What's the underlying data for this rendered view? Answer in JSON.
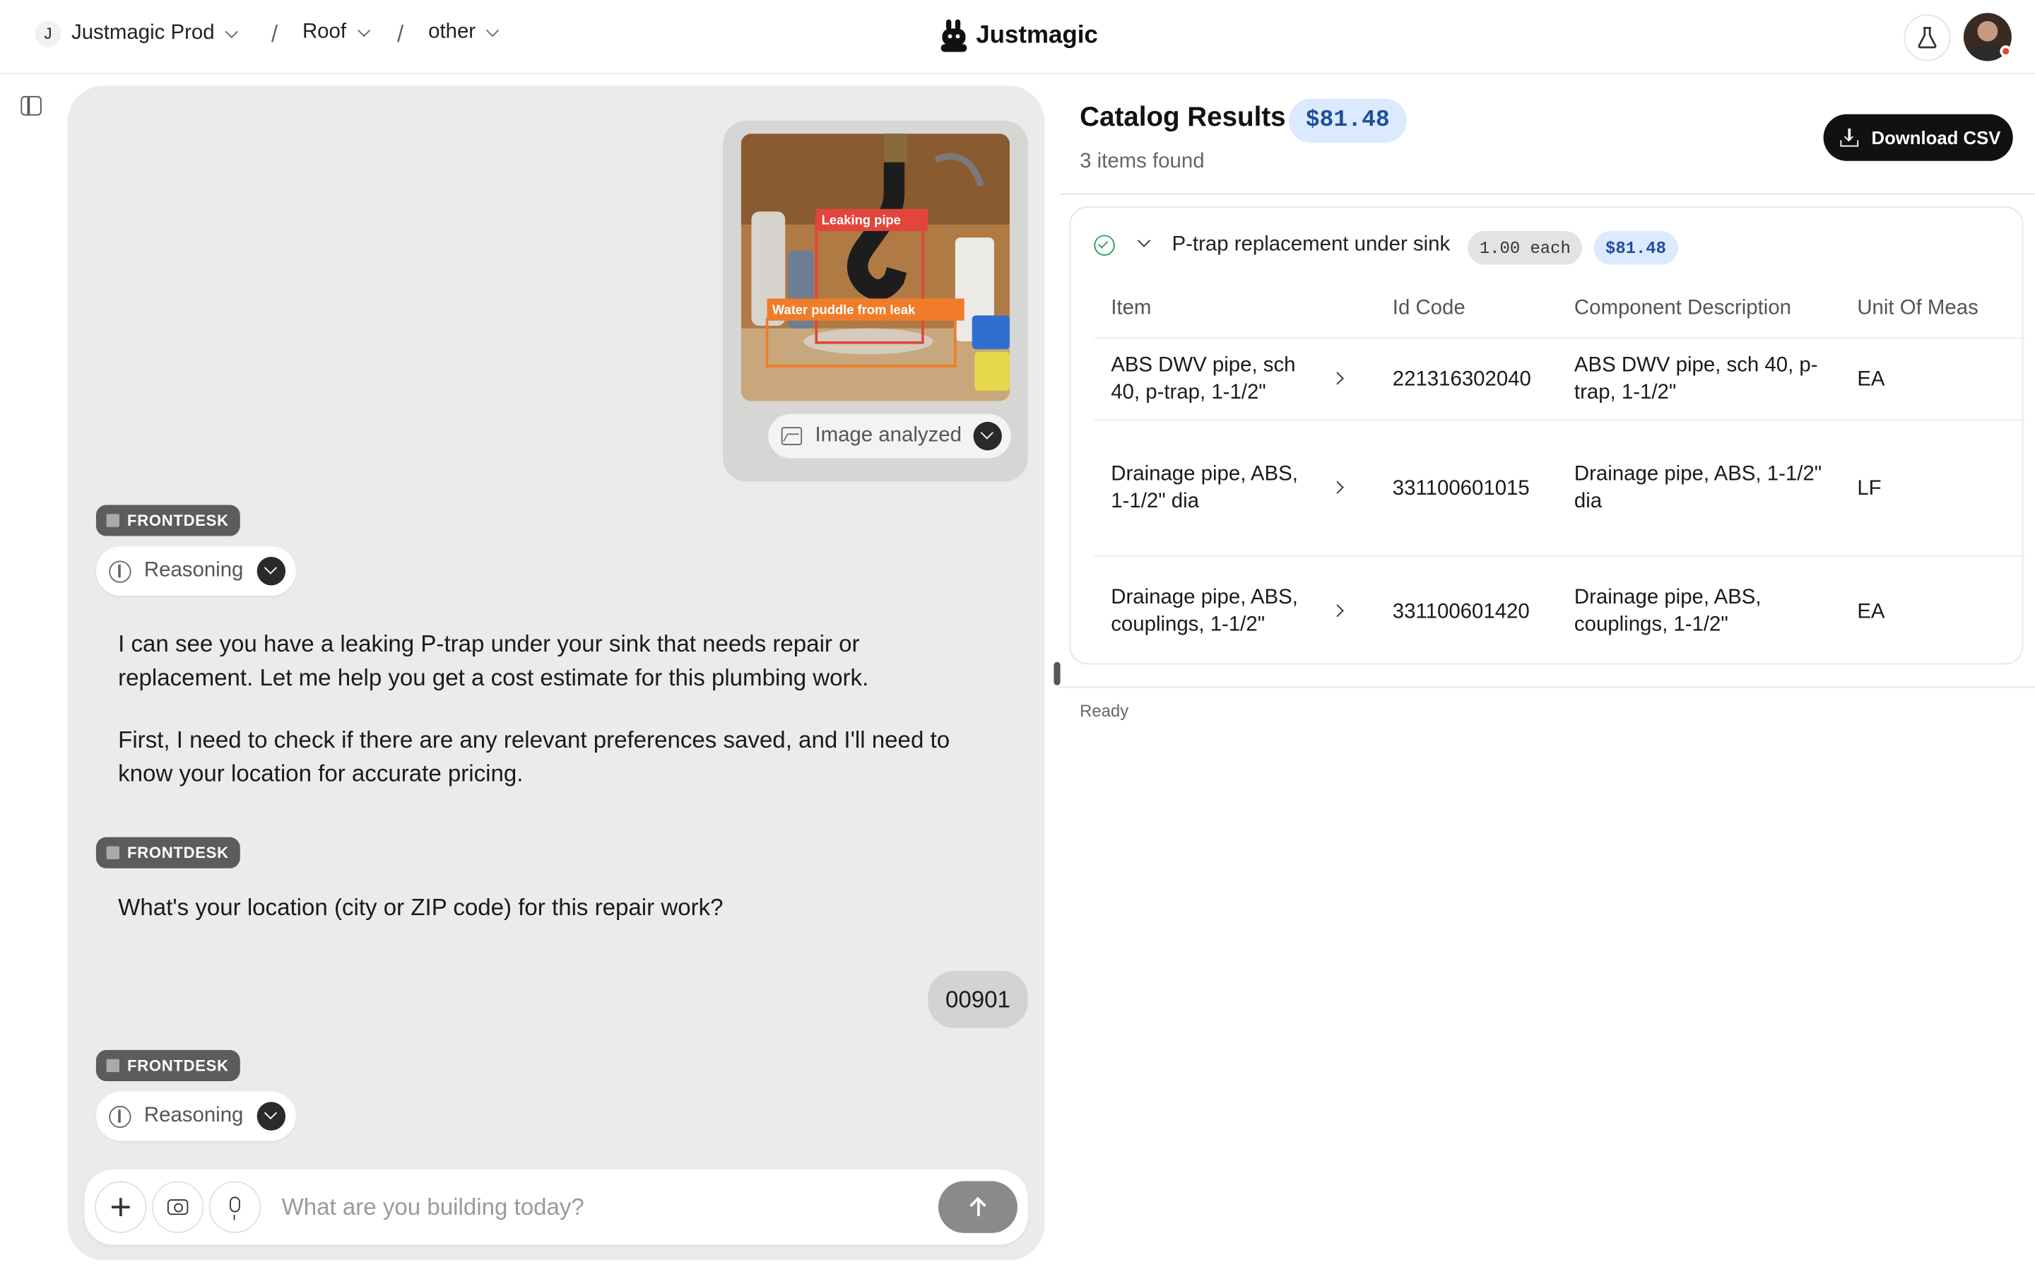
{
  "topbar": {
    "workspace_initial": "J",
    "workspace": "Justmagic Prod",
    "project": "Roof",
    "folder": "other",
    "separator": "/",
    "brand": "Justmagic"
  },
  "chat": {
    "image_card": {
      "labels": [
        "Leaking pipe",
        "Water puddle from leak"
      ],
      "status": "Image analyzed"
    },
    "agent_badge": "FRONTDESK",
    "reasoning_label": "Reasoning",
    "messages": [
      "I can see you have a leaking P-trap under your sink that needs repair or replacement. Let me help you get a cost estimate for this plumbing work.",
      "First, I need to check if there are any relevant preferences saved, and I'll need to know your location for accurate pricing.",
      "What's your location (city or ZIP code) for this repair work?"
    ],
    "user_reply": "00901",
    "composer_placeholder": "What are you building today?"
  },
  "catalog": {
    "title": "Catalog Results",
    "total": "$81.48",
    "count": "3 items found",
    "download_label": "Download CSV",
    "group": {
      "name": "P-trap replacement under sink",
      "quantity": "1.00 each",
      "price": "$81.48"
    },
    "columns": [
      "Item",
      "Id Code",
      "Component Description",
      "Unit Of Meas"
    ],
    "rows": [
      {
        "item_lines": [
          "ABS DWV pipe, sch",
          "40, p-trap, 1-1/2\""
        ],
        "id_code": "221316302040",
        "desc_lines": [
          "ABS DWV pipe, sch 40, p-",
          "trap, 1-1/2\""
        ],
        "unit": "EA"
      },
      {
        "item_lines": [
          "Drainage pipe, ABS,",
          "1-1/2\" dia"
        ],
        "id_code": "331100601015",
        "desc_lines": [
          "Drainage pipe, ABS, 1-1/2\"",
          "dia"
        ],
        "unit": "LF"
      },
      {
        "item_lines": [
          "Drainage pipe, ABS,",
          "couplings, 1-1/2\""
        ],
        "id_code": "331100601420",
        "desc_lines": [
          "Drainage pipe, ABS,",
          "couplings, 1-1/2\""
        ],
        "unit": "EA"
      }
    ],
    "status": "Ready"
  }
}
